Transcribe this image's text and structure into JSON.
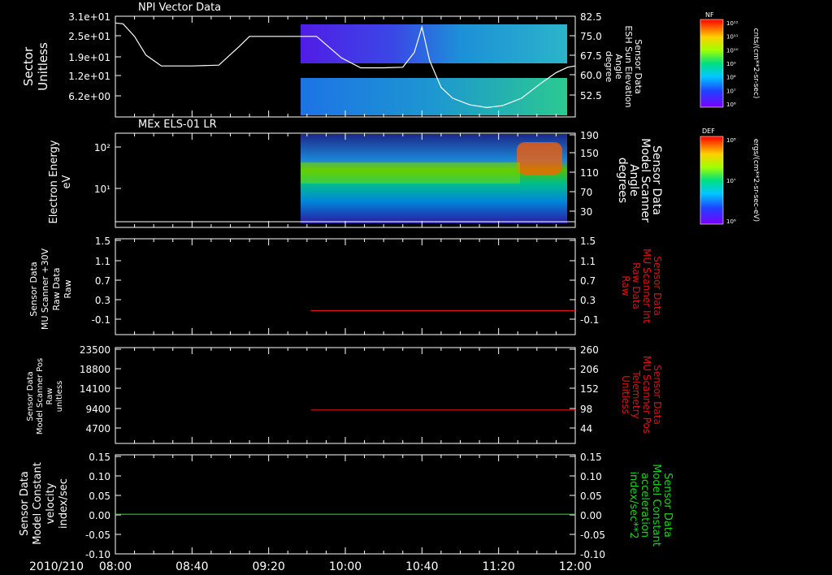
{
  "colors": {
    "white": "#ffffff",
    "red": "#e01010",
    "green": "#20d020",
    "background": "#000000"
  },
  "colorbars": [
    {
      "title": "NF",
      "unit": "cnts/(cm**2-sr-sec)",
      "ticks": [
        "10¹²",
        "10¹¹",
        "10¹⁰",
        "10⁹",
        "10⁸",
        "10⁷",
        "10⁶"
      ]
    },
    {
      "title": "DEF",
      "unit": "ergs/(cm**2-sr-sec-eV)",
      "ticks": [
        "10⁸",
        "10⁷",
        "10⁶"
      ]
    }
  ],
  "x_axis": {
    "date_label": "2010/210",
    "ticks": [
      "08:00",
      "08:40",
      "09:20",
      "10:00",
      "10:40",
      "11:20",
      "12:00"
    ],
    "range": [
      "08:00",
      "12:00"
    ]
  },
  "chart_data": [
    {
      "type": "heatmap",
      "title": "NPI Vector Data",
      "ylabel": [
        "Sector",
        "Unitless"
      ],
      "yticks": [
        "3.1e+01",
        "2.5e+01",
        "1.9e+01",
        "1.2e+01",
        "6.2e+00"
      ],
      "ylabel_right": [
        "Sensor Data",
        "ESH Sun Elevation",
        "Angle",
        "degree"
      ],
      "yticks_right": [
        "82.5",
        "75.0",
        "67.5",
        "60.0",
        "52.5"
      ],
      "yrange_right": [
        45,
        82.5
      ],
      "data_start": "09:42",
      "overlay_series": {
        "name": "ESH Sun Elevation Angle",
        "color": "white",
        "x": [
          "08:00",
          "08:04",
          "08:10",
          "08:16",
          "08:24",
          "08:40",
          "08:54",
          "09:05",
          "09:10",
          "09:20",
          "09:45",
          "09:58",
          "10:08",
          "10:20",
          "10:30",
          "10:36",
          "10:40",
          "10:44",
          "10:50",
          "10:56",
          "11:05",
          "11:14",
          "11:22",
          "11:32",
          "11:42",
          "11:50",
          "11:56",
          "12:00"
        ],
        "y": [
          80,
          79.7,
          75,
          68,
          64,
          64,
          64.3,
          71.5,
          75,
          75,
          75,
          67,
          63.3,
          63.3,
          63.5,
          69,
          78.5,
          66,
          56,
          52,
          49.5,
          48.5,
          49.2,
          52,
          57.5,
          61.5,
          63.5,
          64
        ]
      }
    },
    {
      "type": "heatmap",
      "title": "MEx ELS-01 LR",
      "ylabel": [
        "Electron Energy",
        "eV"
      ],
      "yticks": [
        "10²",
        "10¹"
      ],
      "ylabel_right": [
        "Sensor Data",
        "Model Scanner",
        "Angle",
        "degrees"
      ],
      "yticks_right": [
        "190",
        "150",
        "110",
        "70",
        "30"
      ],
      "yrange_right": [
        0,
        190
      ],
      "data_start": "09:42",
      "overlay_series": {
        "name": "Model Scanner Angle",
        "color": "white",
        "x": [
          "08:00",
          "12:00"
        ],
        "y": [
          5,
          5
        ]
      }
    },
    {
      "type": "line",
      "ylabel": [
        "Sensor Data",
        "MU Scanner +30V",
        "Raw Data",
        "Raw"
      ],
      "yticks": [
        "1.5",
        "1.1",
        "0.7",
        "0.3",
        "-0.1"
      ],
      "ylim": [
        -0.5,
        1.5
      ],
      "ylabel_right": [
        "Sensor Data",
        "MU Scanner Int",
        "Raw Data",
        "Raw"
      ],
      "yticks_right": [
        "1.5",
        "1.1",
        "0.7",
        "0.3",
        "-0.1"
      ],
      "series": [
        {
          "color": "red",
          "x": [
            "09:42",
            "12:00"
          ],
          "y": [
            0.0,
            0.0
          ]
        }
      ]
    },
    {
      "type": "line",
      "ylabel": [
        "Sensor Data",
        "Model Scanner Pos",
        "Raw",
        "unitless"
      ],
      "yticks": [
        "23500",
        "18800",
        "14100",
        "9400",
        "4700"
      ],
      "ylim": [
        0,
        23500
      ],
      "ylabel_right": [
        "Sensor Data",
        "MU Scanner Pos",
        "Telemetry",
        "Unitless"
      ],
      "yticks_right": [
        "260",
        "206",
        "152",
        "98",
        "44"
      ],
      "yrange_right": [
        0,
        260
      ],
      "series": [
        {
          "color": "red",
          "x": [
            "09:42",
            "12:00"
          ],
          "y": [
            8200,
            8200
          ]
        }
      ]
    },
    {
      "type": "line",
      "ylabel": [
        "Sensor Data",
        "Model Constant",
        "velocity",
        "index/sec"
      ],
      "yticks": [
        "0.15",
        "0.10",
        "0.05",
        "0.00",
        "-0.05",
        "-0.10"
      ],
      "ylim": [
        -0.1,
        0.15
      ],
      "ylabel_right": [
        "Sensor Data",
        "Model Constant",
        "acceleration",
        "index/sec**2"
      ],
      "yticks_right": [
        "0.15",
        "0.10",
        "0.05",
        "0.00",
        "-0.05",
        "-0.10"
      ],
      "series": [
        {
          "color": "green",
          "x": [
            "08:00",
            "12:00"
          ],
          "y": [
            0,
            0
          ]
        }
      ]
    }
  ]
}
